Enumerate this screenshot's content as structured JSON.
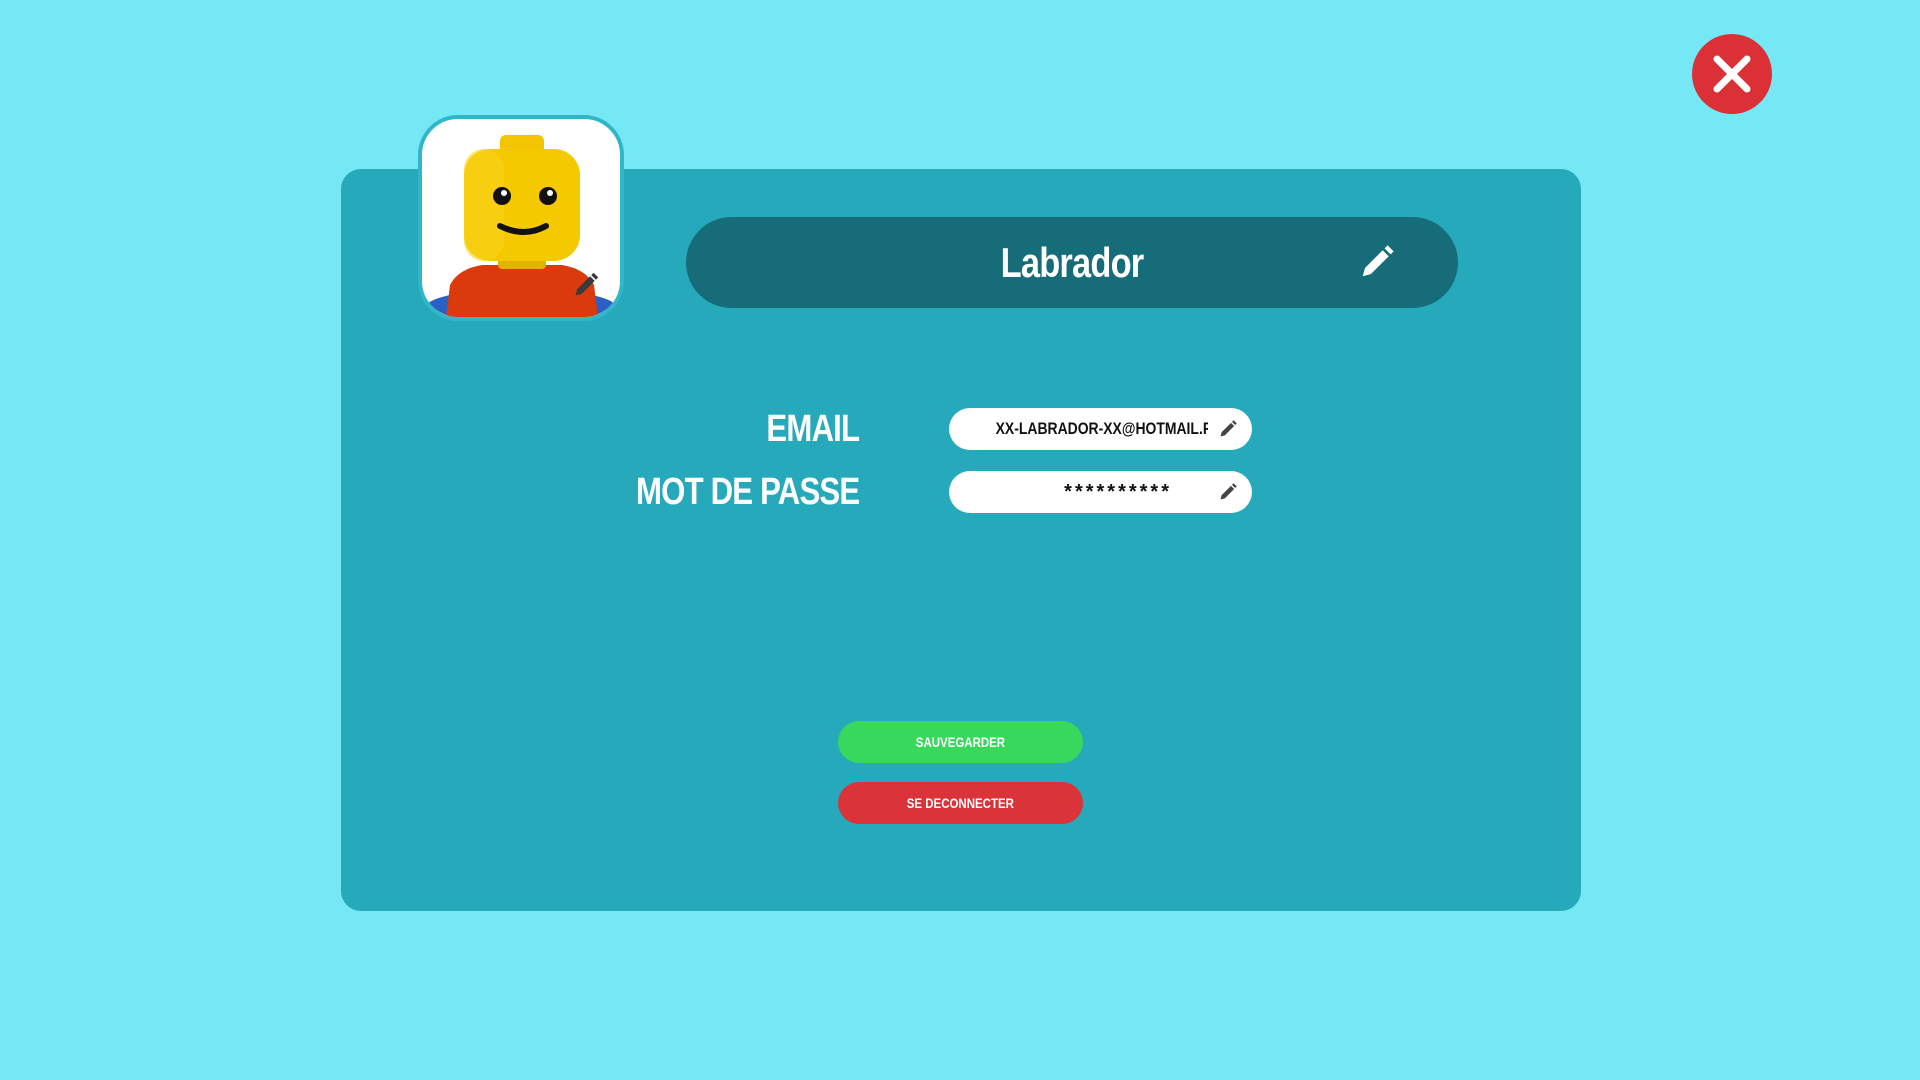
{
  "close": {
    "icon": "close-icon",
    "color": "#dc3037"
  },
  "profile": {
    "avatar_icon": "lego-minifig-head-avatar",
    "username": "Labrador",
    "edit_icon": "pencil-icon"
  },
  "form": {
    "email_label": "EMAIL",
    "email_value": "XX-LABRADOR-XX@HOTMAIL.FR",
    "password_label": "MOT DE PASSE",
    "password_value": "**********"
  },
  "actions": {
    "save_label": "SAUVEGARDER",
    "save_color": "#37d85b",
    "logout_label": "SE DECONNECTER",
    "logout_color": "#db333a"
  },
  "colors": {
    "background": "#76e7f5",
    "panel": "#25a9bb",
    "name_bar": "#166c78"
  }
}
